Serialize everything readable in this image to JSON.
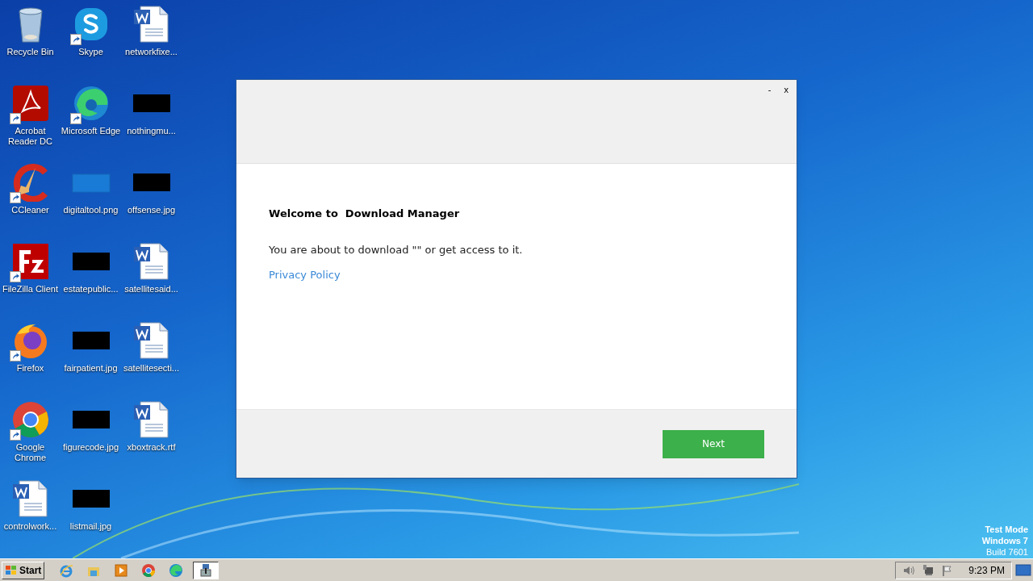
{
  "desktop_columns": [
    [
      {
        "label": "Recycle Bin",
        "kind": "recycle",
        "shortcut": false
      },
      {
        "label": "Acrobat Reader DC",
        "kind": "acrobat",
        "shortcut": true
      },
      {
        "label": "CCleaner",
        "kind": "ccleaner",
        "shortcut": true
      },
      {
        "label": "FileZilla Client",
        "kind": "filezilla",
        "shortcut": true
      },
      {
        "label": "Firefox",
        "kind": "firefox",
        "shortcut": true
      },
      {
        "label": "Google Chrome",
        "kind": "chrome",
        "shortcut": true
      },
      {
        "label": "controlwork...",
        "kind": "word",
        "shortcut": false
      }
    ],
    [
      {
        "label": "Skype",
        "kind": "skype",
        "shortcut": true
      },
      {
        "label": "Microsoft Edge",
        "kind": "edge",
        "shortcut": true
      },
      {
        "label": "digitaltool.png",
        "kind": "blank",
        "shortcut": false
      },
      {
        "label": "estatepublic...",
        "kind": "image",
        "shortcut": false
      },
      {
        "label": "fairpatient.jpg",
        "kind": "image",
        "shortcut": false
      },
      {
        "label": "figurecode.jpg",
        "kind": "image",
        "shortcut": false
      },
      {
        "label": "listmail.jpg",
        "kind": "image",
        "shortcut": false
      }
    ],
    [
      {
        "label": "networkfixe...",
        "kind": "word",
        "shortcut": false
      },
      {
        "label": "nothingmu...",
        "kind": "image",
        "shortcut": false
      },
      {
        "label": "offsense.jpg",
        "kind": "image",
        "shortcut": false
      },
      {
        "label": "satellitesaid...",
        "kind": "word",
        "shortcut": false
      },
      {
        "label": "satellitesecti...",
        "kind": "word",
        "shortcut": false
      },
      {
        "label": "xboxtrack.rtf",
        "kind": "word",
        "shortcut": false
      }
    ]
  ],
  "dialog": {
    "minimize": "-",
    "close": "x",
    "heading": "Welcome to  Download Manager",
    "message": "You are about to download \"\" or get access to it.",
    "link": "Privacy Policy",
    "next_button": "Next"
  },
  "os_notice": [
    "Test Mode",
    "Windows 7",
    "Build 7601"
  ],
  "taskbar": {
    "start": "Start",
    "apps": [
      {
        "kind": "ie",
        "selected": false
      },
      {
        "kind": "explorer",
        "selected": false
      },
      {
        "kind": "media",
        "selected": false
      },
      {
        "kind": "chrome",
        "selected": false
      },
      {
        "kind": "edge",
        "selected": false
      },
      {
        "kind": "installer",
        "selected": true
      }
    ],
    "clock": "9:23 PM"
  }
}
